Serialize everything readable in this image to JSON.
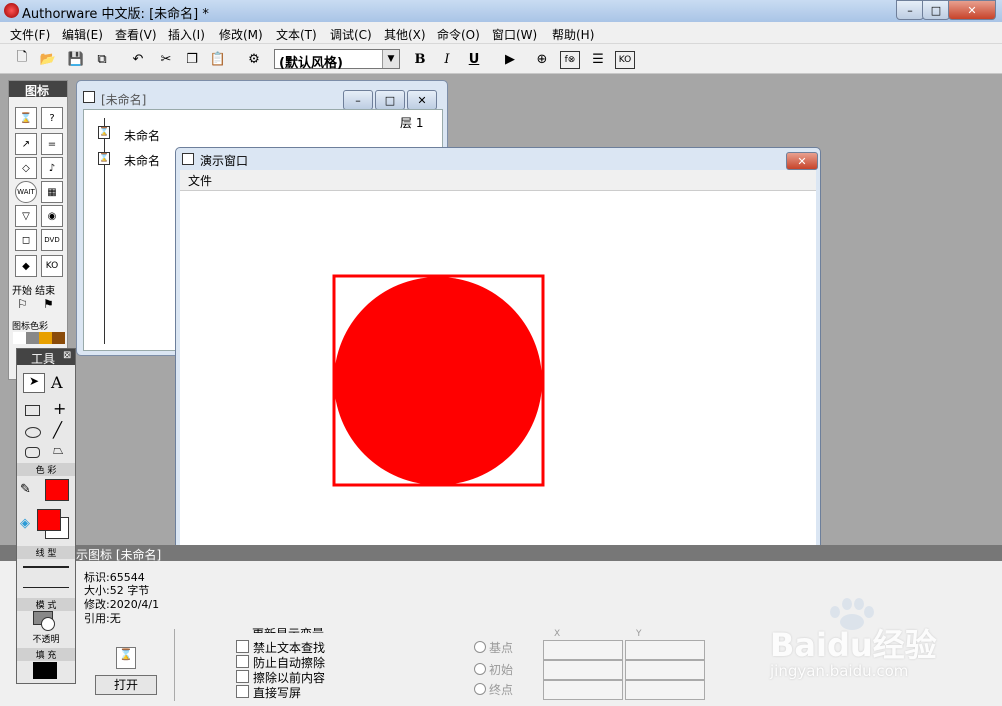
{
  "app": {
    "title": "Authorware 中文版: [未命名] *"
  },
  "menus": [
    "文件(F)",
    "编辑(E)",
    "查看(V)",
    "插入(I)",
    "修改(M)",
    "文本(T)",
    "调试(C)",
    "其他(X)",
    "命令(O)",
    "窗口(W)",
    "帮助(H)"
  ],
  "toolbar": {
    "style_select": "(默认风格)",
    "bold": "B",
    "italic": "I",
    "underline": "U"
  },
  "icon_palette": {
    "title": "图标",
    "start_end": "开始 结束",
    "icon_color": "图标色彩"
  },
  "flow_window": {
    "title": "[未命名]",
    "level_label": "层 1",
    "items": [
      "未命名",
      "未命名"
    ]
  },
  "presentation": {
    "title": "演示窗口",
    "menu_file": "文件",
    "shape_color": "#ff0000"
  },
  "tools": {
    "title": "工具",
    "color_label": "色 彩",
    "line_label": "线 型",
    "mode_label": "模 式",
    "mode_value": "不透明",
    "fill_label": "填 充",
    "pen_color": "#ff0000",
    "fill_color": "#ff0000"
  },
  "properties": {
    "header": "示图标 [未命名]",
    "id": "标识:65544",
    "size": "大小:52 字节",
    "modified": "修改:2020/4/1",
    "ref": "引用:无",
    "open_button": "打开",
    "partial_label": "更新显示变量",
    "checkboxes": [
      "禁止文本查找",
      "防止自动擦除",
      "擦除以前内容",
      "直接写屏"
    ],
    "radios": [
      "基点",
      "初始",
      "终点"
    ],
    "col_x": "X",
    "col_y": "Y"
  },
  "watermark": {
    "brand": "Baidu经验",
    "url": "jingyan.baidu.com"
  }
}
